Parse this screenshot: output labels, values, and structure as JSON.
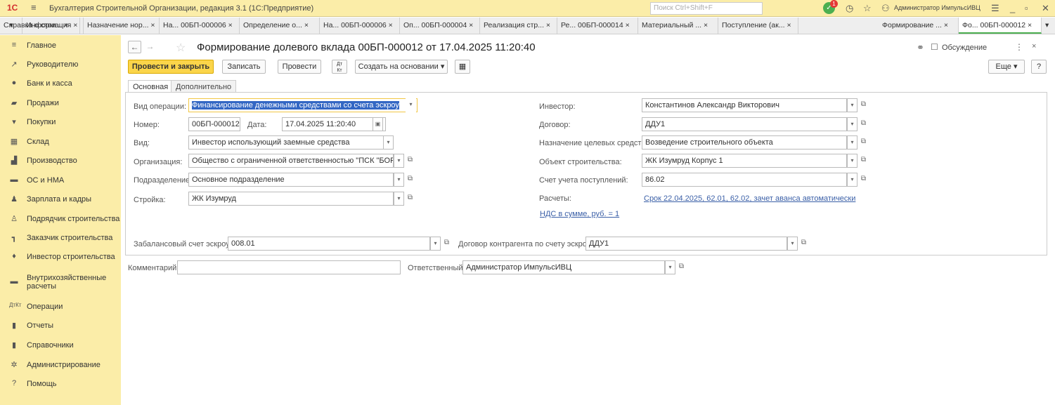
{
  "app": {
    "logo": "1С",
    "title": "Бухгалтерия Строительной Организации, редакция 3.1  (1С:Предприятие)",
    "search_placeholder": "Поиск Ctrl+Shift+F",
    "notifications": "1",
    "user": "Администратор ИмпульсИВЦ"
  },
  "tabs": [
    "Информация ×",
    "Назначение нор... ×",
    "На... 00БП-000006 ×",
    "Определение о... ×",
    "На... 00БП-000006 ×",
    "Оп... 00БП-000004 ×",
    "Реализация стр... ×",
    "Ре... 00БП-000014 ×",
    "Материальный ... ×",
    "Поступление (ак... ×",
    "Справка о стои... ×",
    "Формирование ... ×",
    "Фо... 00БП-000012 ×"
  ],
  "sidebar": [
    "Главное",
    "Руководителю",
    "Банк и касса",
    "Продажи",
    "Покупки",
    "Склад",
    "Производство",
    "ОС и НМА",
    "Зарплата и кадры",
    "Подрядчик строительства",
    "Заказчик строительства",
    "Инвестор строительства",
    "Внутрихозяйственные расчеты",
    "Операции",
    "Отчеты",
    "Справочники",
    "Администрирование",
    "Помощь"
  ],
  "document": {
    "title": "Формирование долевого вклада 00БП-000012 от 17.04.2025 11:20:40",
    "discussion": "Обсуждение"
  },
  "toolbar": {
    "post_close": "Провести и закрыть",
    "save": "Записать",
    "post": "Провести",
    "create_based": "Создать на основании",
    "more": "Еще",
    "help": "?"
  },
  "form_tabs": {
    "main": "Основная",
    "extra": "Дополнительно"
  },
  "form": {
    "op_type_label": "Вид операции:",
    "op_type": "Финансирование денежными средствами со счета эскроу",
    "number_label": "Номер:",
    "number": "00БП-000012",
    "date_label": "Дата:",
    "date": "17.04.2025 11:20:40",
    "kind_label": "Вид:",
    "kind": "Инвестор использующий заемные средства",
    "org_label": "Организация:",
    "org": "Общество с ограниченной ответственностью \"ПСК \"БОР\"",
    "dept_label": "Подразделение:",
    "dept": "Основное подразделение",
    "site_label": "Стройка:",
    "site": "ЖК Изумруд",
    "investor_label": "Инвестор:",
    "investor": "Константинов Александр Викторович",
    "contract_label": "Договор:",
    "contract": "ДДУ1",
    "purpose_label": "Назначение целевых средств:",
    "purpose": "Возведение строительного объекта",
    "object_label": "Объект строительства:",
    "object": "ЖК Изумруд Корпус 1",
    "account_label": "Счет учета поступлений:",
    "account": "86.02",
    "settle_label": "Расчеты:",
    "settle_link": "Срок 22.04.2025, 62.01, 62.02, зачет аванса автоматически",
    "vat_link": "НДС в сумме, руб. = 1",
    "escrow_acc_label": "Забалансовый счет эскроу:",
    "escrow_acc": "008.01",
    "escrow_contract_label": "Договор контрагента по счету эскроу:",
    "escrow_contract": "ДДУ1",
    "comment_label": "Комментарий:",
    "comment": "",
    "resp_label": "Ответственный:",
    "resp": "Администратор ИмпульсИВЦ"
  }
}
